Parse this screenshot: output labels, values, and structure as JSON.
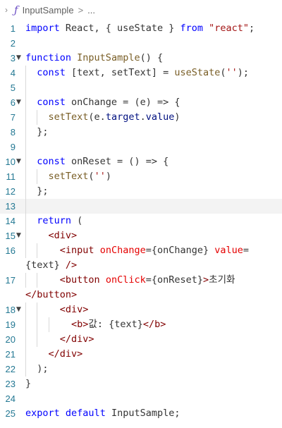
{
  "breadcrumb": {
    "chevron_icon": "chevron-right-icon",
    "function_icon": "function-symbol-icon",
    "function_glyph": "ƒ",
    "symbol": "InputSample",
    "separator": ">",
    "more": "..."
  },
  "colors": {
    "keyword": "#0000ff",
    "function": "#795e26",
    "string": "#a31515",
    "tag": "#800000",
    "attribute": "#e50000",
    "line_number": "#237893",
    "active_line_bg": "#f3f3f3"
  },
  "editor": {
    "active_line": 13,
    "lines": [
      {
        "n": "1",
        "tokens": [
          [
            "kw",
            "import"
          ],
          [
            "plain",
            " React, { useState } "
          ],
          [
            "kw",
            "from"
          ],
          [
            "plain",
            " "
          ],
          [
            "str",
            "\"react\""
          ],
          [
            "plain",
            ";"
          ]
        ]
      },
      {
        "n": "2",
        "tokens": []
      },
      {
        "n": "3",
        "fold": true,
        "tokens": [
          [
            "kw",
            "function"
          ],
          [
            "plain",
            " "
          ],
          [
            "fn",
            "InputSample"
          ],
          [
            "plain",
            "() {"
          ]
        ]
      },
      {
        "n": "4",
        "tokens": [
          [
            "plain",
            "  "
          ],
          [
            "kw",
            "const"
          ],
          [
            "plain",
            " [text, setText] = "
          ],
          [
            "fn",
            "useState"
          ],
          [
            "plain",
            "("
          ],
          [
            "str",
            "''"
          ],
          [
            "plain",
            ");"
          ]
        ]
      },
      {
        "n": "5",
        "tokens": []
      },
      {
        "n": "6",
        "fold": true,
        "tokens": [
          [
            "plain",
            "  "
          ],
          [
            "kw",
            "const"
          ],
          [
            "plain",
            " onChange = (e) => {"
          ]
        ]
      },
      {
        "n": "7",
        "tokens": [
          [
            "plain",
            "    "
          ],
          [
            "fn",
            "setText"
          ],
          [
            "plain",
            "(e."
          ],
          [
            "var",
            "target"
          ],
          [
            "plain",
            "."
          ],
          [
            "var",
            "value"
          ],
          [
            "plain",
            ")"
          ]
        ]
      },
      {
        "n": "8",
        "tokens": [
          [
            "plain",
            "  };"
          ]
        ]
      },
      {
        "n": "9",
        "tokens": []
      },
      {
        "n": "10",
        "fold": true,
        "tokens": [
          [
            "plain",
            "  "
          ],
          [
            "kw",
            "const"
          ],
          [
            "plain",
            " onReset = () => {"
          ]
        ]
      },
      {
        "n": "11",
        "tokens": [
          [
            "plain",
            "    "
          ],
          [
            "fn",
            "setText"
          ],
          [
            "plain",
            "("
          ],
          [
            "str",
            "''"
          ],
          [
            "plain",
            ")"
          ]
        ]
      },
      {
        "n": "12",
        "tokens": [
          [
            "plain",
            "  };"
          ]
        ]
      },
      {
        "n": "13",
        "tokens": []
      },
      {
        "n": "14",
        "tokens": [
          [
            "plain",
            "  "
          ],
          [
            "kw",
            "return"
          ],
          [
            "plain",
            " ("
          ]
        ]
      },
      {
        "n": "15",
        "fold": true,
        "tokens": [
          [
            "plain",
            "    "
          ],
          [
            "tag",
            "<div>"
          ]
        ]
      },
      {
        "n": "16",
        "tokens": [
          [
            "plain",
            "      "
          ],
          [
            "tag",
            "<input"
          ],
          [
            "plain",
            " "
          ],
          [
            "attr",
            "onChange"
          ],
          [
            "plain",
            "={onChange} "
          ],
          [
            "attr",
            "value"
          ],
          [
            "plain",
            "="
          ]
        ]
      },
      {
        "n": "",
        "wrapped": true,
        "tokens": [
          [
            "plain",
            "{text} "
          ],
          [
            "tag",
            "/>"
          ]
        ]
      },
      {
        "n": "17",
        "tokens": [
          [
            "plain",
            "      "
          ],
          [
            "tag",
            "<button"
          ],
          [
            "plain",
            " "
          ],
          [
            "attr",
            "onClick"
          ],
          [
            "plain",
            "={onReset}"
          ],
          [
            "tag",
            ">"
          ],
          [
            "plain",
            "초기화"
          ]
        ]
      },
      {
        "n": "",
        "wrapped": true,
        "tokens": [
          [
            "tag",
            "</button>"
          ]
        ]
      },
      {
        "n": "18",
        "fold": true,
        "tokens": [
          [
            "plain",
            "      "
          ],
          [
            "tag",
            "<div>"
          ]
        ]
      },
      {
        "n": "19",
        "tokens": [
          [
            "plain",
            "        "
          ],
          [
            "tag",
            "<b>"
          ],
          [
            "plain",
            "값: {text}"
          ],
          [
            "tag",
            "</b>"
          ]
        ]
      },
      {
        "n": "20",
        "tokens": [
          [
            "plain",
            "      "
          ],
          [
            "tag",
            "</div>"
          ]
        ]
      },
      {
        "n": "21",
        "tokens": [
          [
            "plain",
            "    "
          ],
          [
            "tag",
            "</div>"
          ]
        ]
      },
      {
        "n": "22",
        "tokens": [
          [
            "plain",
            "  );"
          ]
        ]
      },
      {
        "n": "23",
        "tokens": [
          [
            "plain",
            "}"
          ]
        ]
      },
      {
        "n": "24",
        "tokens": []
      },
      {
        "n": "25",
        "tokens": [
          [
            "kw",
            "export"
          ],
          [
            "plain",
            " "
          ],
          [
            "kw",
            "default"
          ],
          [
            "plain",
            " InputSample;"
          ]
        ]
      }
    ]
  }
}
